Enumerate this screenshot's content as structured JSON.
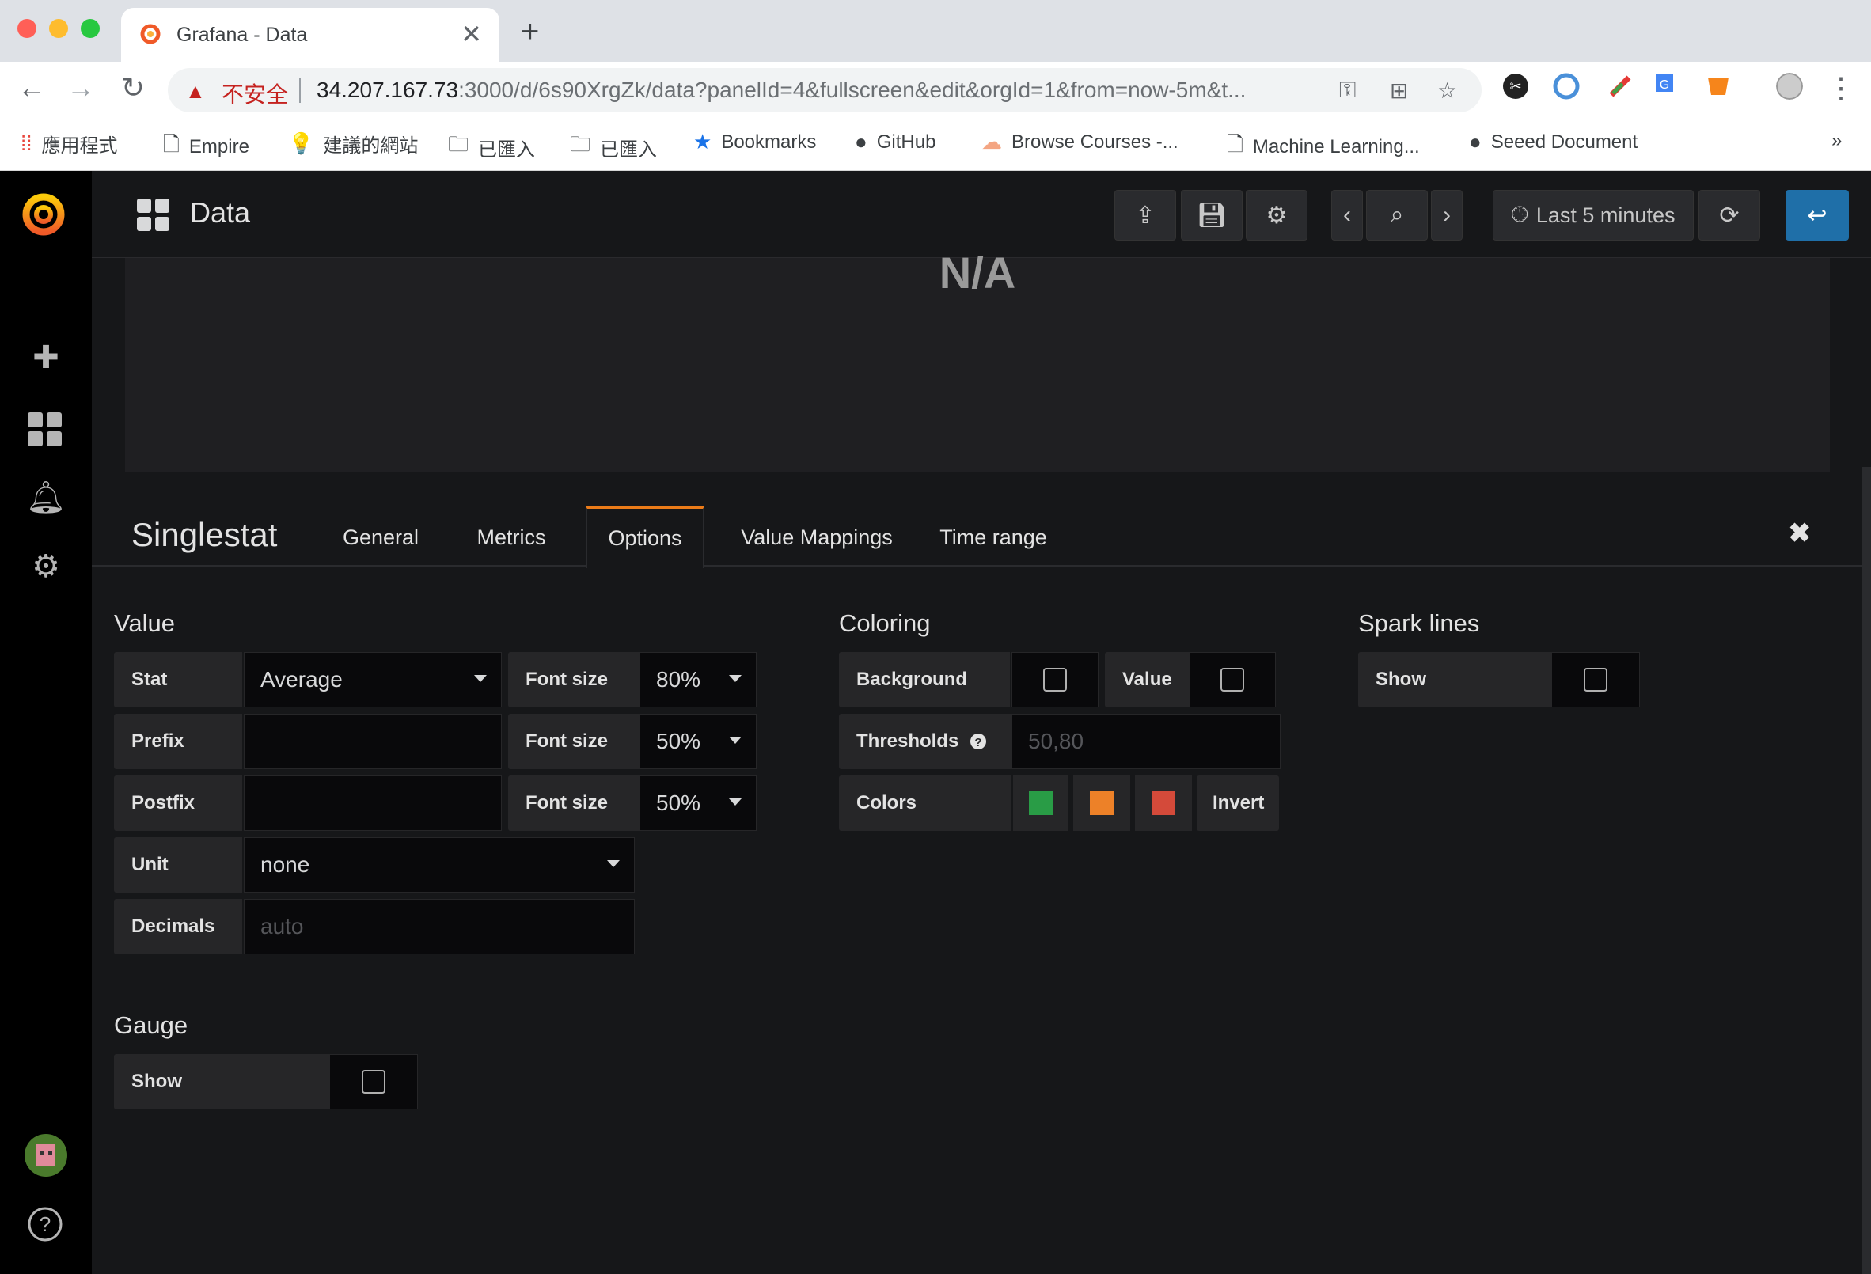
{
  "browser": {
    "tab_title": "Grafana - Data",
    "tab_close": "✕",
    "new_tab": "+",
    "security_label": "不安全",
    "url_host": "34.207.167.73",
    "url_path": ":3000/d/6s90XrgZk/data?panelId=4&fullscreen&edit&orgId=1&from=now-5m&t...",
    "bookmarks": [
      {
        "icon": "apps-icon",
        "label": "應用程式"
      },
      {
        "icon": "page-icon",
        "label": "Empire"
      },
      {
        "icon": "bulb-icon",
        "label": "建議的網站"
      },
      {
        "icon": "folder-icon",
        "label": "已匯入"
      },
      {
        "icon": "folder-icon",
        "label": "已匯入"
      },
      {
        "icon": "star-icon",
        "label": "Bookmarks"
      },
      {
        "icon": "github-icon",
        "label": "GitHub"
      },
      {
        "icon": "cloud-icon",
        "label": "Browse Courses -..."
      },
      {
        "icon": "page-icon",
        "label": "Machine Learning..."
      },
      {
        "icon": "github-icon",
        "label": "Seeed Document"
      }
    ],
    "bookmarks_more": "»"
  },
  "grafana": {
    "dashboard_title": "Data",
    "time_range": "Last 5 minutes",
    "panel_value": "N/A",
    "editor": {
      "panel_type": "Singlestat",
      "tabs": [
        "General",
        "Metrics",
        "Options",
        "Value Mappings",
        "Time range"
      ],
      "active_tab": "Options",
      "close": "✖"
    },
    "value_section": {
      "title": "Value",
      "stat_label": "Stat",
      "stat_value": "Average",
      "prefix_label": "Prefix",
      "postfix_label": "Postfix",
      "font_size_label": "Font size",
      "font_sizes": [
        "80%",
        "50%",
        "50%"
      ],
      "unit_label": "Unit",
      "unit_value": "none",
      "decimals_label": "Decimals",
      "decimals_placeholder": "auto"
    },
    "coloring_section": {
      "title": "Coloring",
      "background_label": "Background",
      "value_label": "Value",
      "thresholds_label": "Thresholds",
      "thresholds_placeholder": "50,80",
      "colors_label": "Colors",
      "colors": [
        "#299c46",
        "#ed8128",
        "#d44a3a"
      ],
      "invert_label": "Invert"
    },
    "spark_section": {
      "title": "Spark lines",
      "show_label": "Show"
    },
    "gauge_section": {
      "title": "Gauge",
      "show_label": "Show"
    }
  }
}
